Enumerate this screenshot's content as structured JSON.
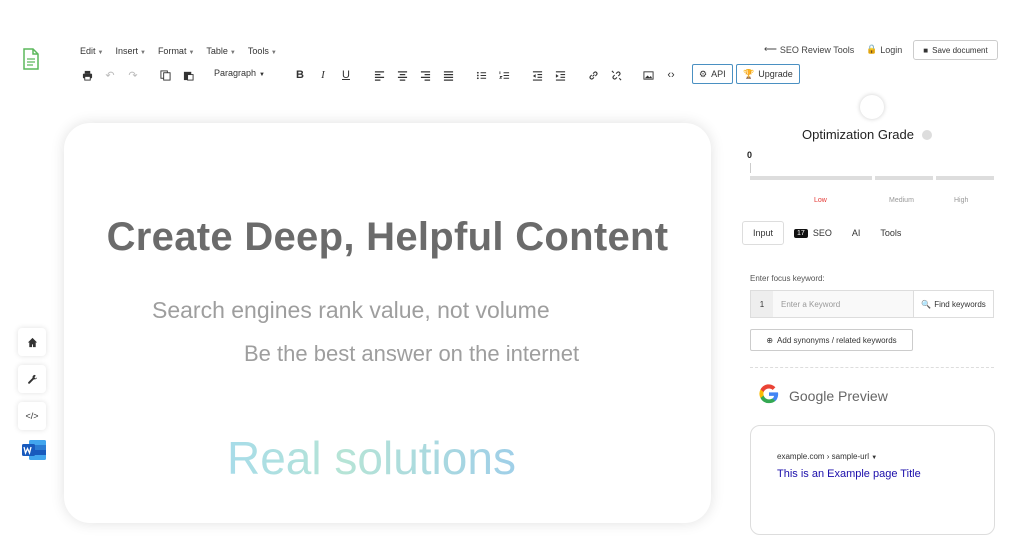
{
  "menu": [
    "Edit",
    "Insert",
    "Format",
    "Table",
    "Tools"
  ],
  "toolbar": {
    "paragraph": "Paragraph",
    "api": "API",
    "upgrade": "Upgrade"
  },
  "top": {
    "seo_tools": "SEO Review Tools",
    "login": "Login",
    "save": "Save document"
  },
  "editor": {
    "title": "Create Deep, Helpful Content",
    "sub1": "Search engines rank value, not volume",
    "sub2": "Be the best answer on the internet",
    "sub3": "Real solutions"
  },
  "grade": {
    "title": "Optimization Grade",
    "value": "0",
    "low": "Low",
    "medium": "Medium",
    "high": "High"
  },
  "tabs": {
    "input": "Input",
    "seo_count": "17",
    "seo": "SEO",
    "ai": "AI",
    "tools": "Tools"
  },
  "keyword": {
    "label": "Enter focus keyword:",
    "row_number": "1",
    "placeholder": "Enter a Keyword",
    "find": "Find keywords",
    "synonyms": "Add synonyms / related keywords"
  },
  "google_preview": {
    "title": "Google Preview",
    "url": "example.com › sample-url",
    "page_title": "This is an Example page Title"
  },
  "colors": {
    "accent": "#4a90c2",
    "low": "#e53935",
    "link": "#1a0dab"
  }
}
